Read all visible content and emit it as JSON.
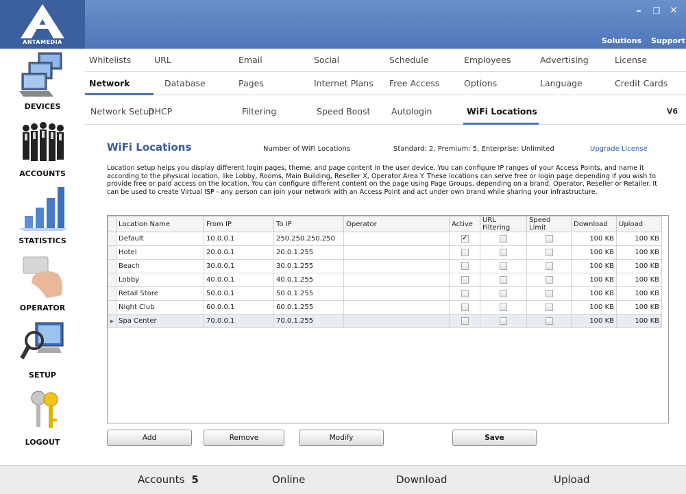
{
  "app": {
    "logo_text": "ANTAMEDIA",
    "minimize": "–",
    "restore": "❐",
    "close": "✕",
    "topnav": [
      "Solutions",
      "Support"
    ]
  },
  "sidebar": {
    "items": [
      {
        "label": "DEVICES",
        "icon": "devices-icon"
      },
      {
        "label": "ACCOUNTS",
        "icon": "accounts-icon"
      },
      {
        "label": "STATISTICS",
        "icon": "statistics-icon"
      },
      {
        "label": "OPERATOR",
        "icon": "operator-icon"
      },
      {
        "label": "SETUP",
        "icon": "setup-icon"
      },
      {
        "label": "LOGOUT",
        "icon": "logout-icon"
      }
    ]
  },
  "tabs": {
    "row1": [
      "Whitelists",
      "URL",
      "Email",
      "Social",
      "Schedule",
      "Employees",
      "Advertising",
      "License"
    ],
    "row2": [
      "Network",
      "Database",
      "Pages",
      "Internet Plans",
      "Free Access",
      "Options",
      "Language",
      "Credit Cards"
    ],
    "row3": [
      "Network Setup",
      "DHCP",
      "Filtering",
      "Speed Boost",
      "Autologin",
      "WiFi Locations"
    ],
    "version": "V6"
  },
  "main": {
    "title": "WiFi Locations",
    "count_label": "Number of WiFi Locations",
    "count_value": "Standard: 2, Premium: 5, Enterprise: Unlimited",
    "upgrade_link": "Upgrade License",
    "description": "Location setup helps you display different login pages, theme, and page content in the user device. You can configure IP ranges of your Access Points, and name it according to the physical location, like Lobby, Rooms, Main Building, Reseller X, Operator Area Y. These locations can serve free or login page depending if you wish to provide free or paid access on the location. You can configure different content on the page using Page Groups, depending on a brand, Operator, Reseller or Retailer. It can be used to create Virtual ISP - any person can join your network with an Access Point and act under own brand while sharing your infrastructure."
  },
  "grid": {
    "columns": [
      "Location Name",
      "From IP",
      "To IP",
      "Operator",
      "Active",
      "URL Filtering",
      "Speed Limit",
      "Download",
      "Upload"
    ],
    "rows": [
      {
        "name": "Default",
        "from": "10.0.0.1",
        "to": "250.250.250.250",
        "operator": "",
        "active": true,
        "url_filtering": false,
        "speed_limit": false,
        "download": "100 KB",
        "upload": "100 KB"
      },
      {
        "name": "Hotel",
        "from": "20.0.0.1",
        "to": "20.0.1.255",
        "operator": "",
        "active": false,
        "url_filtering": false,
        "speed_limit": false,
        "download": "100 KB",
        "upload": "100 KB"
      },
      {
        "name": "Beach",
        "from": "30.0.0.1",
        "to": "30.0.1.255",
        "operator": "",
        "active": false,
        "url_filtering": false,
        "speed_limit": false,
        "download": "100 KB",
        "upload": "100 KB"
      },
      {
        "name": "Lobby",
        "from": "40.0.0.1",
        "to": "40.0.1.255",
        "operator": "",
        "active": false,
        "url_filtering": false,
        "speed_limit": false,
        "download": "100 KB",
        "upload": "100 KB"
      },
      {
        "name": "Retail Store",
        "from": "50.0.0.1",
        "to": "50.0.1.255",
        "operator": "",
        "active": false,
        "url_filtering": false,
        "speed_limit": false,
        "download": "100 KB",
        "upload": "100 KB"
      },
      {
        "name": "Night Club",
        "from": "60.0.0.1",
        "to": "60.0.1.255",
        "operator": "",
        "active": false,
        "url_filtering": false,
        "speed_limit": false,
        "download": "100 KB",
        "upload": "100 KB"
      },
      {
        "name": "Spa Center",
        "from": "70.0.0.1",
        "to": "70.0.1.255",
        "operator": "",
        "active": false,
        "url_filtering": false,
        "speed_limit": false,
        "download": "100 KB",
        "upload": "100 KB"
      }
    ],
    "selected_indicator": "▶"
  },
  "buttons": {
    "add": "Add",
    "remove": "Remove",
    "modify": "Modify",
    "save": "Save"
  },
  "status": {
    "accounts_label": "Accounts",
    "accounts_value": "5",
    "online_label": "Online",
    "download_label": "Download",
    "upload_label": "Upload"
  },
  "colors": {
    "titlebar": "#5a80c0",
    "accent": "#4a72b0",
    "title_text": "#3a5c96"
  }
}
